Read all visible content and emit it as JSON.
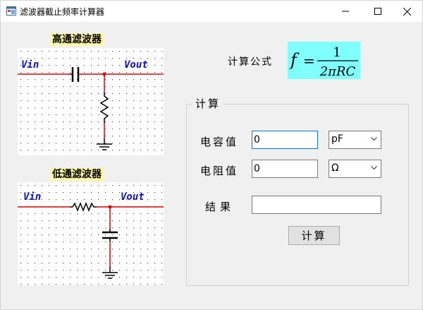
{
  "window": {
    "title": "滤波器截止频率计算器"
  },
  "high_pass": {
    "title": "高通滤波器",
    "vin": "Vin",
    "vout": "Vout"
  },
  "low_pass": {
    "title": "低通滤波器",
    "vin": "Vin",
    "vout": "Vout"
  },
  "formula": {
    "label": "计算公式",
    "lhs": "f",
    "eq": "=",
    "numerator": "1",
    "denominator": "2πRC"
  },
  "calc_group": {
    "title": "计算",
    "capacitance": {
      "label": "电容值",
      "value": "0",
      "unit": "pF"
    },
    "resistance": {
      "label": "电阻值",
      "value": "0",
      "unit": "Ω"
    },
    "result": {
      "label": "结果",
      "value": ""
    },
    "button": "计算"
  },
  "colors": {
    "wire": "#e00000",
    "component": "#000000",
    "label_text": "#1010c0",
    "title_highlight": "#fff9a6",
    "formula_bg": "#80ffff"
  },
  "icons": {
    "minimize": "minimize-icon",
    "maximize": "maximize-icon",
    "close": "close-icon",
    "dropdown": "chevron-down-icon"
  }
}
